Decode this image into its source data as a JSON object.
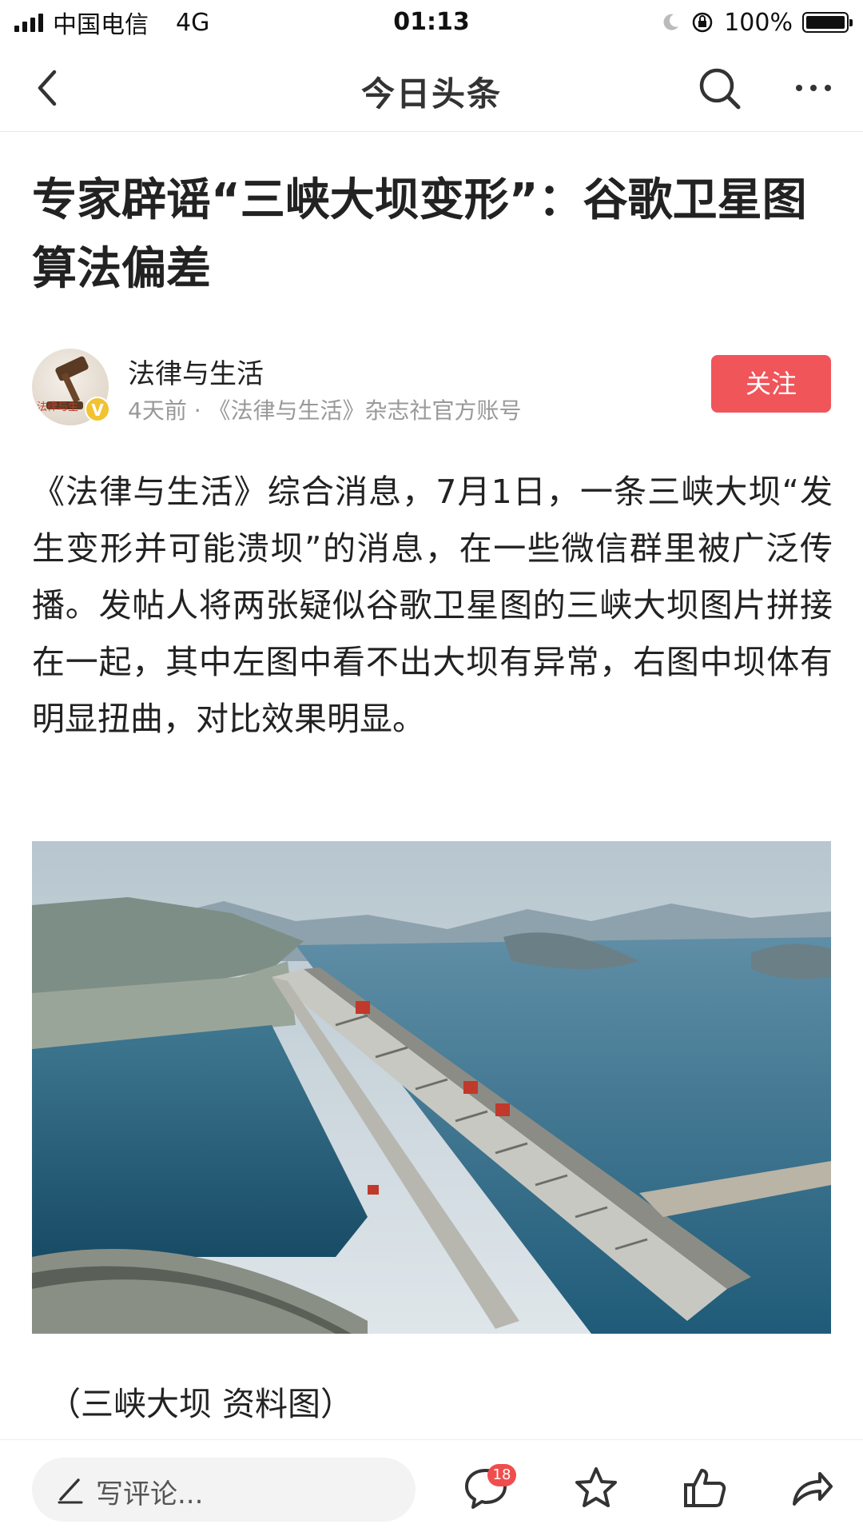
{
  "status_bar": {
    "carrier": "中国电信",
    "network": "4G",
    "time": "01:13",
    "battery": "100%"
  },
  "header": {
    "title": "今日头条",
    "icons": [
      "back-icon",
      "search-icon",
      "more-icon"
    ]
  },
  "article": {
    "title": "专家辟谣“三峡大坝变形”：谷歌卫星图算法偏差",
    "author": {
      "name": "法律与生活",
      "meta": "4天前 · 《法律与生活》杂志社官方账号",
      "avatar_text": "法律与生"
    },
    "follow_label": "关注",
    "body": "《法律与生活》综合消息，7月1日，一条三峡大坝“发生变形并可能溃坝”的消息，在一些微信群里被广泛传播。发帖人将两张疑似谷歌卫星图的三峡大坝图片拼接在一起，其中左图中看不出大坝有异常，右图中坝体有明显扭曲，对比效果明显。",
    "image_caption": "（三峡大坝 资料图）"
  },
  "bottom_bar": {
    "comment_placeholder": "写评论...",
    "comment_count": "18",
    "icons": [
      "pencil-icon",
      "comment-icon",
      "star-icon",
      "like-icon",
      "share-icon"
    ]
  },
  "colors": {
    "follow_button": "#f0555a",
    "badge": "#f04d4d",
    "meta_text": "#999999"
  }
}
